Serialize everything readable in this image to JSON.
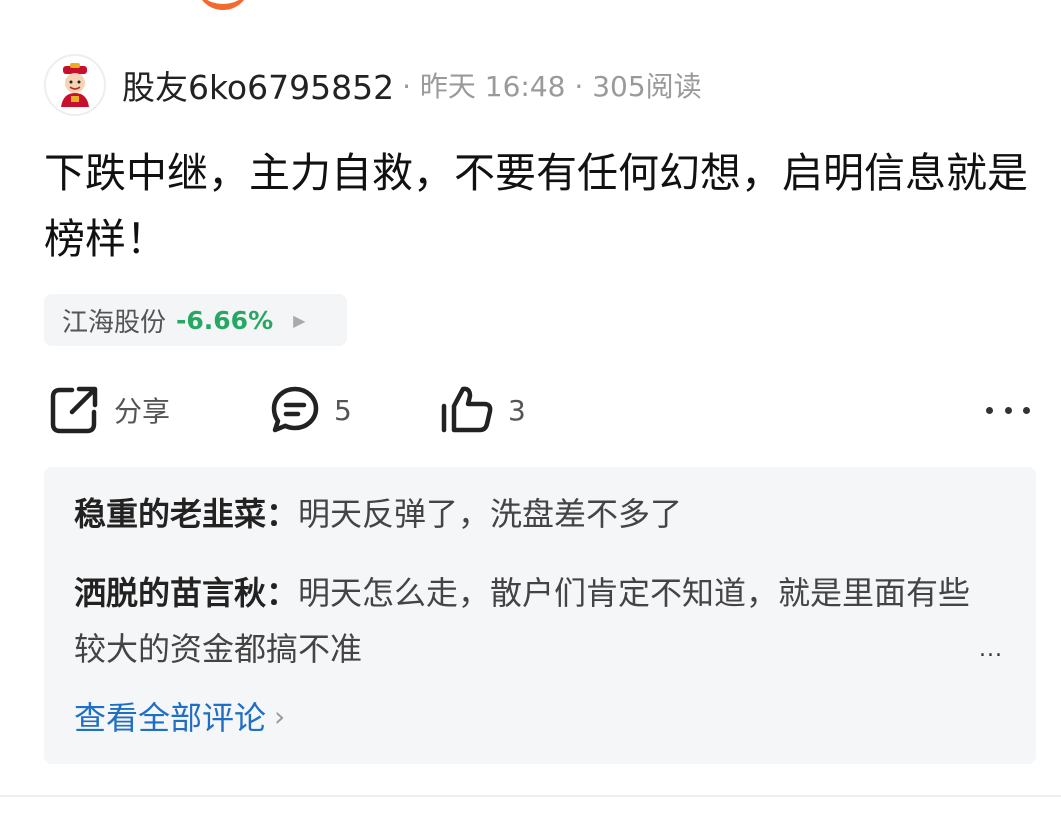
{
  "post": {
    "username": "股友6ko6795852",
    "meta": "· 昨天 16:48 · 305阅读",
    "text": "下跌中继，主力自救，不要有任何幻想，启明信息就是榜样！"
  },
  "stock": {
    "name": "江海股份",
    "change": "-6.66%",
    "change_color": "#27a862",
    "arrow_icon": "play-right-icon"
  },
  "actions": {
    "share_label": "分享",
    "comment_count": "5",
    "like_count": "3"
  },
  "comments": [
    {
      "author": "稳重的老韭菜：",
      "text": "明天反弹了，洗盘差不多了"
    },
    {
      "author": "洒脱的苗言秋：",
      "text": "明天怎么走，散户们肯定不知道，就是里面有些较大的资金都搞不准"
    }
  ],
  "comments_more": "...",
  "view_all": {
    "label": "查看全部评论",
    "chevron": "›",
    "color": "#1f6fc4"
  }
}
